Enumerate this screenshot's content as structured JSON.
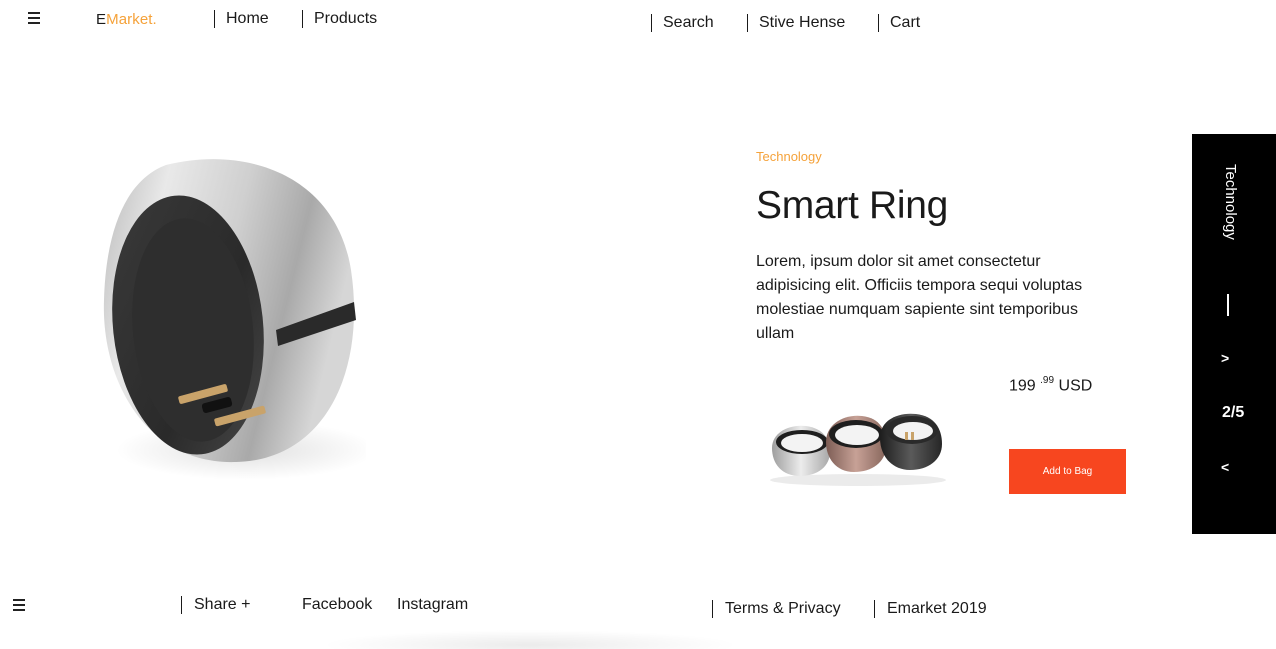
{
  "header": {
    "brand_first": "E",
    "brand_rest": "Market.",
    "nav": [
      {
        "label": "Home"
      },
      {
        "label": "Products"
      }
    ],
    "right": [
      {
        "label": "Search"
      },
      {
        "label": "Stive Hense"
      },
      {
        "label": "Cart"
      }
    ]
  },
  "product": {
    "category": "Technology",
    "title": "Smart Ring",
    "description": "Lorem, ipsum dolor sit amet consectetur adipisicing elit. Officiis tempora sequi voluptas molestiae numquam sapiente sint temporibus ullam",
    "price_main": "199",
    "price_cents": ".99",
    "price_currency": "USD",
    "add_button": "Add to Bag"
  },
  "side_panel": {
    "label": "Technology",
    "next": ">",
    "counter": "2/5",
    "prev": "<"
  },
  "footer": {
    "share": "Share +",
    "facebook": "Facebook",
    "instagram": "Instagram",
    "terms": "Terms & Privacy",
    "copyright": "Emarket 2019"
  },
  "colors": {
    "accent": "#f5a23a",
    "button": "#f7461f",
    "panel": "#000000"
  },
  "icons": {
    "menu": "hamburger-menu-icon"
  }
}
